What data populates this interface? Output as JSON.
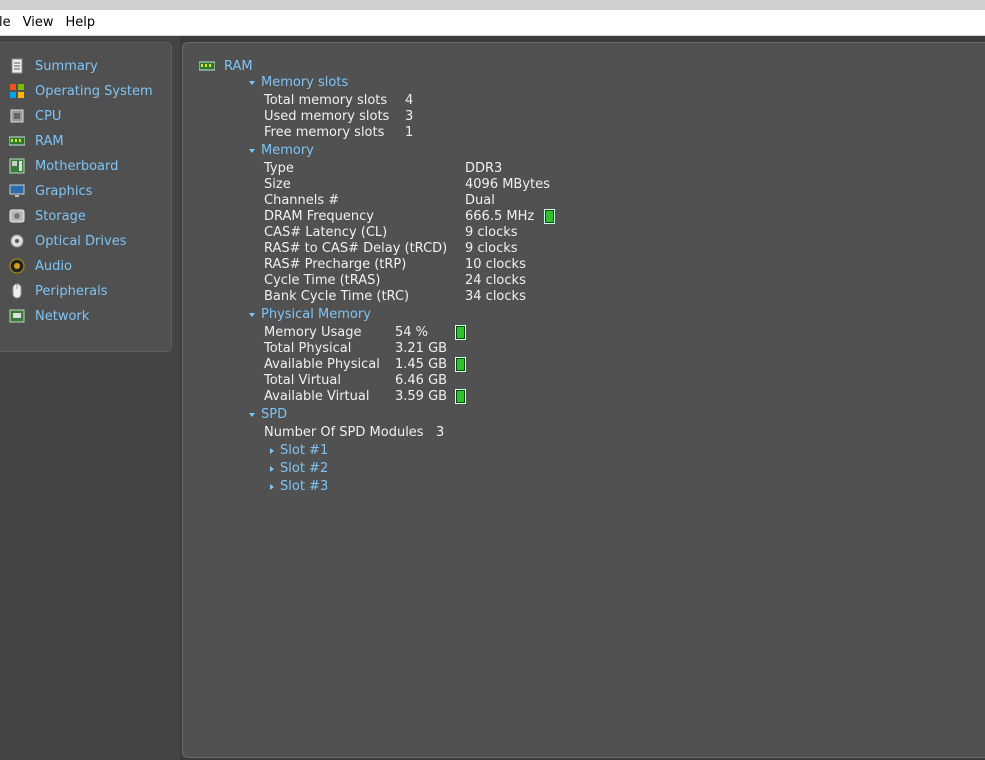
{
  "menu": [
    "le",
    "View",
    "Help"
  ],
  "sidebar": {
    "items": [
      {
        "label": "Summary",
        "icon": "summary-icon"
      },
      {
        "label": "Operating System",
        "icon": "windows-icon"
      },
      {
        "label": "CPU",
        "icon": "cpu-icon"
      },
      {
        "label": "RAM",
        "icon": "ram-icon"
      },
      {
        "label": "Motherboard",
        "icon": "motherboard-icon"
      },
      {
        "label": "Graphics",
        "icon": "monitor-icon"
      },
      {
        "label": "Storage",
        "icon": "storage-icon"
      },
      {
        "label": "Optical Drives",
        "icon": "disc-icon"
      },
      {
        "label": "Audio",
        "icon": "speaker-icon"
      },
      {
        "label": "Peripherals",
        "icon": "mouse-icon"
      },
      {
        "label": "Network",
        "icon": "network-icon"
      }
    ]
  },
  "main": {
    "title": "RAM",
    "memory_slots": {
      "header": "Memory slots",
      "rows": [
        [
          "Total memory slots",
          "4"
        ],
        [
          "Used memory slots",
          "3"
        ],
        [
          "Free memory slots",
          "1"
        ]
      ]
    },
    "memory": {
      "header": "Memory",
      "rows": [
        [
          "Type",
          "DDR3"
        ],
        [
          "Size",
          "4096 MBytes"
        ],
        [
          "Channels #",
          "Dual"
        ],
        [
          "DRAM Frequency",
          "666.5 MHz"
        ],
        [
          "CAS# Latency (CL)",
          "9 clocks"
        ],
        [
          "RAS# to CAS# Delay (tRCD)",
          "9 clocks"
        ],
        [
          "RAS# Precharge (tRP)",
          "10 clocks"
        ],
        [
          "Cycle Time (tRAS)",
          "24 clocks"
        ],
        [
          "Bank Cycle Time (tRC)",
          "34 clocks"
        ]
      ]
    },
    "physical": {
      "header": "Physical Memory",
      "rows": [
        [
          "Memory Usage",
          "54 %"
        ],
        [
          "Total Physical",
          "3.21 GB"
        ],
        [
          "Available Physical",
          "1.45 GB"
        ],
        [
          "Total Virtual",
          "6.46 GB"
        ],
        [
          "Available Virtual",
          "3.59 GB"
        ]
      ]
    },
    "spd": {
      "header": "SPD",
      "modules_label": "Number Of SPD Modules",
      "modules_value": "3",
      "slots": [
        "Slot #1",
        "Slot #2",
        "Slot #3"
      ]
    }
  },
  "colors": {
    "accent": "#7fc4f5",
    "panel": "#515151",
    "meter": "#2fbf2f"
  }
}
